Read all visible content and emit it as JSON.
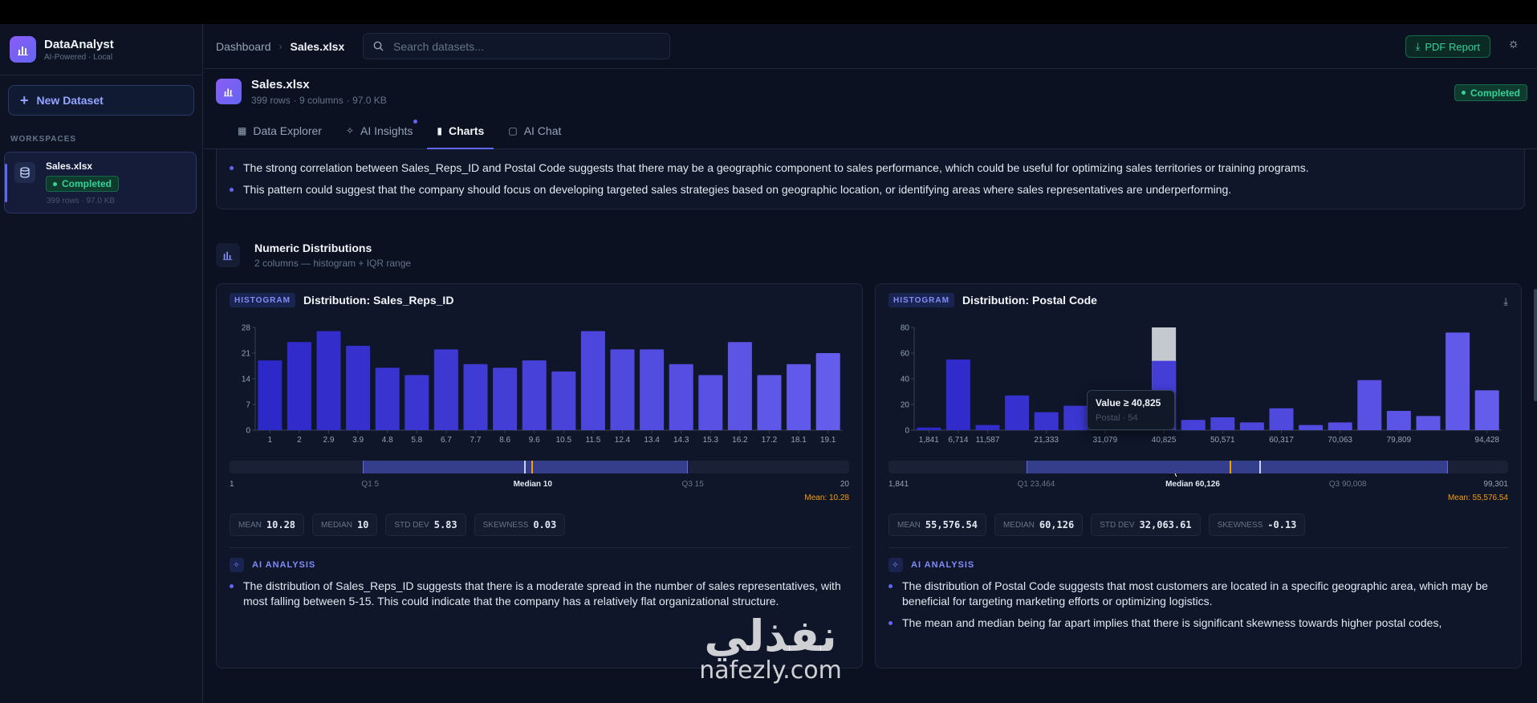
{
  "app": {
    "name": "DataAnalyst",
    "tagline": "AI-Powered · Local"
  },
  "sidebar": {
    "new_button": "New Dataset",
    "section_label": "WORKSPACES",
    "items": [
      {
        "name": "Sales.xlsx",
        "status": "Completed",
        "meta": "399 rows · 97.0 KB"
      }
    ]
  },
  "header": {
    "breadcrumb_root": "Dashboard",
    "breadcrumb_current": "Sales.xlsx",
    "search_placeholder": "Search datasets...",
    "pdf_button": "PDF Report"
  },
  "file": {
    "name": "Sales.xlsx",
    "rows": "399 rows",
    "columns": "· 9 columns",
    "size": "· 97.0 KB",
    "status": "Completed"
  },
  "tabs": [
    {
      "label": "Data Explorer",
      "icon": "table-icon"
    },
    {
      "label": "AI Insights",
      "icon": "sparkles-icon"
    },
    {
      "label": "Charts",
      "icon": "bar-chart-icon"
    },
    {
      "label": "AI Chat",
      "icon": "chat-icon"
    }
  ],
  "insights": {
    "bullets": [
      "The strong correlation between Sales_Reps_ID and Postal Code suggests that there may be a geographic component to sales performance, which could be useful for optimizing sales territories or training programs.",
      "This pattern could suggest that the company should focus on developing targeted sales strategies based on geographic location, or identifying areas where sales representatives are underperforming."
    ]
  },
  "section": {
    "title": "Numeric Distributions",
    "subtitle": "2 columns — histogram + IQR range"
  },
  "cards": [
    {
      "badge": "HISTOGRAM",
      "title": "Distribution: Sales_Reps_ID",
      "iqr": {
        "min": "1",
        "q1": "Q1 5",
        "median": "Median 10",
        "q3": "Q3 15",
        "max": "20",
        "mean": "Mean: 10.28"
      },
      "stats": [
        {
          "label": "MEAN",
          "value": "10.28"
        },
        {
          "label": "MEDIAN",
          "value": "10"
        },
        {
          "label": "STD DEV",
          "value": "5.83"
        },
        {
          "label": "SKEWNESS",
          "value": "0.03"
        }
      ],
      "ai_label": "AI ANALYSIS",
      "ai_bullets": [
        "The distribution of Sales_Reps_ID suggests that there is a moderate spread in the number of sales representatives, with most falling between 5-15. This could indicate that the company has a relatively flat organizational structure."
      ]
    },
    {
      "badge": "HISTOGRAM",
      "title": "Distribution: Postal Code",
      "iqr": {
        "min": "1,841",
        "q1": "Q1 23,464",
        "median": "Median 60,126",
        "q3": "Q3 90,008",
        "max": "99,301",
        "mean": "Mean: 55,576.54"
      },
      "stats": [
        {
          "label": "MEAN",
          "value": "55,576.54"
        },
        {
          "label": "MEDIAN",
          "value": "60,126"
        },
        {
          "label": "STD DEV",
          "value": "32,063.61"
        },
        {
          "label": "SKEWNESS",
          "value": "-0.13"
        }
      ],
      "ai_label": "AI ANALYSIS",
      "ai_bullets": [
        "The distribution of Postal Code suggests that most customers are located in a specific geographic area, which may be beneficial for targeting marketing efforts or optimizing logistics.",
        "The mean and median being far apart implies that there is significant skewness towards higher postal codes,"
      ],
      "tooltip": {
        "title": "Value ≥ 40,825",
        "sub": "Postal · 54"
      }
    }
  ],
  "chart_data": [
    {
      "type": "bar",
      "title": "Distribution: Sales_Reps_ID",
      "ylim": [
        0,
        28
      ],
      "yticks": [
        "0",
        "7",
        "14",
        "21",
        "28"
      ],
      "xticks": [
        "1",
        "2",
        "2.9",
        "3.9",
        "4.8",
        "5.8",
        "6.7",
        "7.7",
        "8.6",
        "9.6",
        "10.5",
        "11.5",
        "12.4",
        "13.4",
        "14.3",
        "15.3",
        "16.2",
        "17.2",
        "18.1",
        "19.1"
      ],
      "values": [
        19,
        24,
        27,
        23,
        17,
        15,
        22,
        18,
        17,
        19,
        16,
        27,
        22,
        22,
        18,
        15,
        24,
        15,
        18,
        21
      ]
    },
    {
      "type": "bar",
      "title": "Distribution: Postal Code",
      "ylim": [
        0,
        80
      ],
      "yticks": [
        "0",
        "20",
        "40",
        "60",
        "80"
      ],
      "xticks": [
        "1,841",
        "6,714",
        "11,587",
        "21,333",
        "31,079",
        "40,825",
        "50,571",
        "60,317",
        "70,063",
        "79,809",
        "94,428"
      ],
      "xtick_bins": [
        0,
        1,
        2,
        4,
        6,
        8,
        10,
        12,
        14,
        16,
        19
      ],
      "values": [
        2,
        55,
        4,
        27,
        14,
        19,
        18,
        7,
        54,
        8,
        10,
        6,
        17,
        4,
        6,
        39,
        15,
        11,
        76,
        31
      ],
      "highlight_bin": 8
    }
  ],
  "watermark": {
    "arabic": "نفذلي",
    "latin": "nafezly.com"
  },
  "colors": {
    "accent": "#6366f1",
    "success": "#34d399",
    "mean": "#f59e0b"
  }
}
